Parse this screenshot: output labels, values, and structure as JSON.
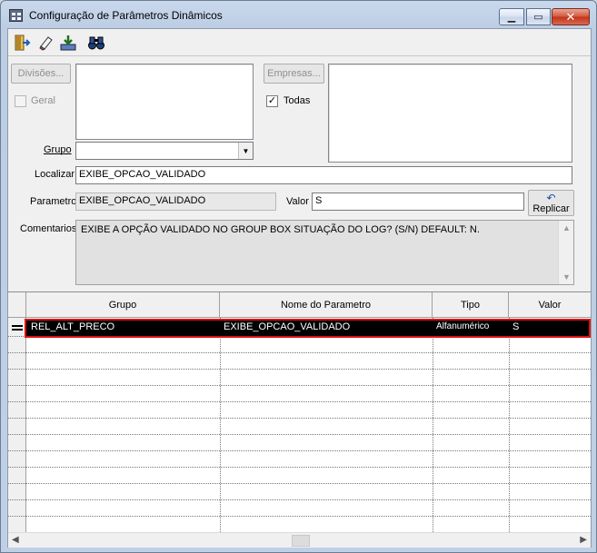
{
  "window": {
    "title": "Configuração de Parâmetros Dinâmicos"
  },
  "toolbar": {
    "icons": [
      "exit-icon",
      "eraser-icon",
      "download-tray-icon",
      "binoculars-icon"
    ]
  },
  "divisoes_button": "Divisões...",
  "geral_label": "Geral",
  "empresas_button": "Empresas...",
  "todas_label": "Todas",
  "todas_checked": "✓",
  "grupo_label": "Grupo",
  "grupo_value": "",
  "localizar_label": "Localizar",
  "localizar_value": "EXIBE_OPCAO_VALIDADO",
  "parametro_label": "Parametro",
  "parametro_value": "EXIBE_OPCAO_VALIDADO",
  "valor_label": "Valor",
  "valor_value": "S",
  "replicar_label": "Replicar",
  "comentarios_label": "Comentarios",
  "comentarios_value": "EXIBE A OPÇÃO VALIDADO NO GROUP BOX SITUAÇÃO DO LOG? (S/N) DEFAULT: N.",
  "grid": {
    "headers": [
      "Grupo",
      "Nome do Parametro",
      "Tipo",
      "Valor"
    ],
    "rows": [
      {
        "grupo": "REL_ALT_PRECO",
        "nome": "EXIBE_OPCAO_VALIDADO",
        "tipo": "Alfanumérico",
        "valor": "S"
      }
    ]
  },
  "colors": {
    "selection_frame": "#e01010",
    "selected_row": "#000000"
  }
}
